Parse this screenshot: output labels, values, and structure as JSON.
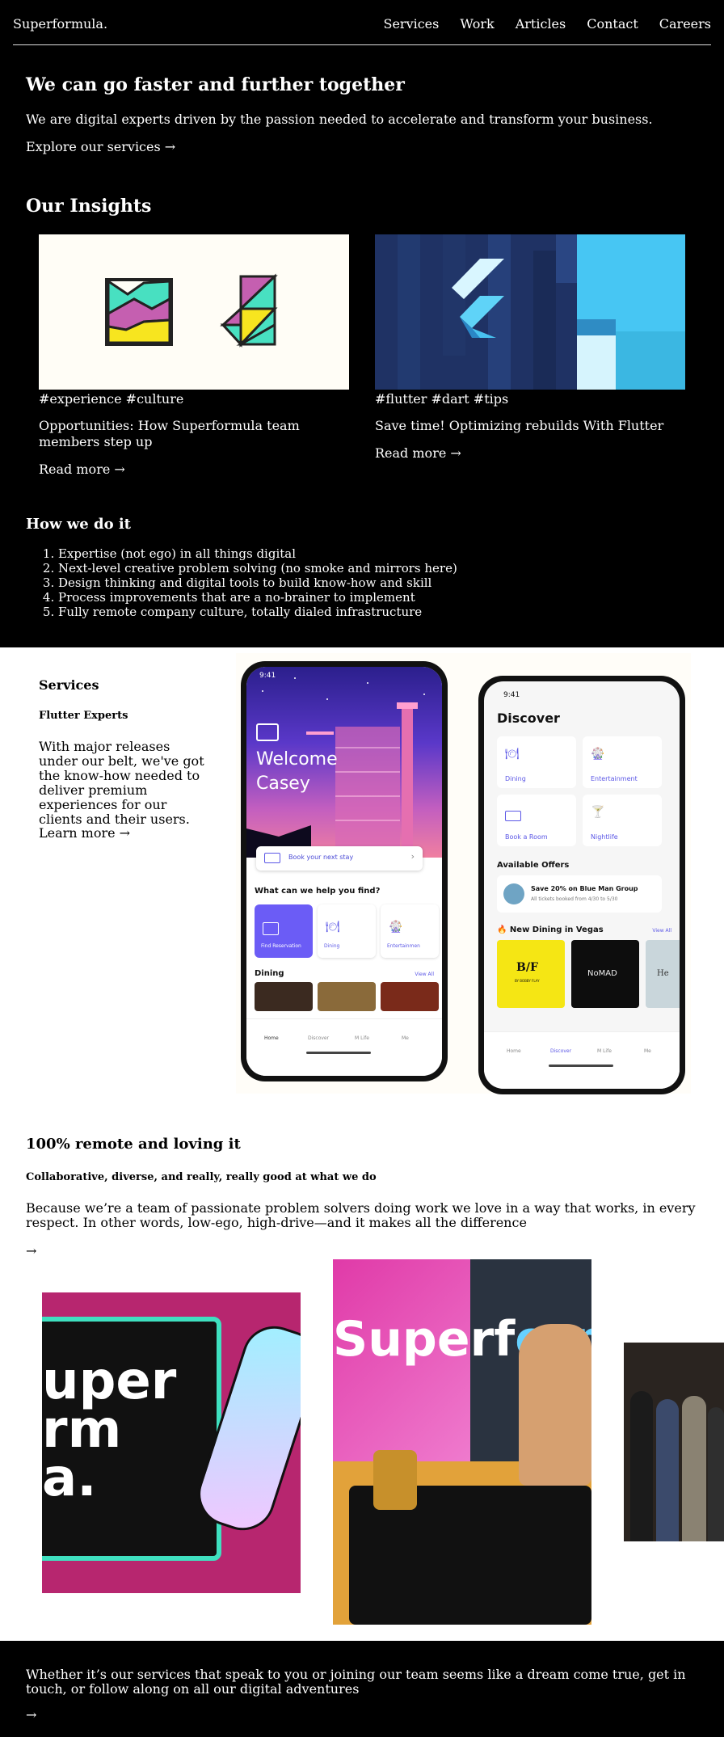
{
  "header": {
    "logo": "Superformula.",
    "nav": [
      "Services",
      "Work",
      "Articles",
      "Contact",
      "Careers"
    ]
  },
  "hero": {
    "title": "We can go faster and further together",
    "subtitle": "We are digital experts driven by the passion needed to accelerate and transform your business.",
    "link": "Explore our services →"
  },
  "insights": {
    "title": "Our Insights",
    "cards": [
      {
        "tags": "#experience #culture",
        "title": "Opportunities: How Superformula team members step up",
        "link": "Read more →"
      },
      {
        "tags": "#flutter #dart #tips",
        "title": "Save time! Optimizing rebuilds With Flutter",
        "link": "Read more →"
      }
    ]
  },
  "how": {
    "title": "How we do it",
    "items": [
      "Expertise (not ego) in all things digital",
      "Next-level creative problem solving (no smoke and mirrors here)",
      "Design thinking and digital tools to build know-how and skill",
      "Process improvements that are a no-brainer to implement",
      "Fully remote company culture, totally dialed infrastructure"
    ]
  },
  "services": {
    "title": "Services",
    "subtitle": "Flutter Experts",
    "body": "With major releases under our belt, we've got the know-how needed to deliver premium experiences for our clients and their users.",
    "link": "Learn more →"
  },
  "phone1": {
    "time": "9:41",
    "welcome": "Welcome",
    "name": "Casey",
    "book": "Book your next stay",
    "question": "What can we help you find?",
    "tiles": [
      "Find Reservation",
      "Dining",
      "Entertainmen"
    ],
    "dining": "Dining",
    "view_all": "View All",
    "tabs": [
      "Home",
      "Discover",
      "M Life",
      "Me"
    ]
  },
  "phone2": {
    "time": "9:41",
    "title": "Discover",
    "tiles": [
      "Dining",
      "Entertainment",
      "Book a Room",
      "Nightlife"
    ],
    "offers_title": "Available Offers",
    "offer_title": "Save 20% on Blue Man Group",
    "offer_sub": "All tickets booked from 4/30 to 5/30",
    "new_dining": "🔥 New Dining in Vegas",
    "view_all": "View All",
    "restaurants": [
      "B/F",
      "BY BOBBY FLAY",
      "NoMAD",
      "He"
    ],
    "tabs": [
      "Home",
      "Discover",
      "M Life",
      "Me"
    ]
  },
  "remote": {
    "title": "100% remote and loving it",
    "subtitle": "Collaborative, diverse, and really, really good at what we do",
    "body": "Because we’re a team of passionate problem solvers doing work we love in a way that works, in every respect. In other words, low-ego, high-drive—and it makes all the difference",
    "arrow": "→",
    "photo_texts": [
      "uper",
      "rm",
      "a.",
      "Superf",
      "ormul"
    ]
  },
  "footer": {
    "text": "Whether it’s our services that speak to you or joining our team seems like a dream come true, get in touch, or follow along on all our digital adventures",
    "arrow": "→"
  },
  "colors": {
    "black": "#000000",
    "accent": "#6b5cf6",
    "flutter_navy": "#1f3264",
    "flutter_sky": "#47c6f3",
    "pink": "#b7266f"
  }
}
